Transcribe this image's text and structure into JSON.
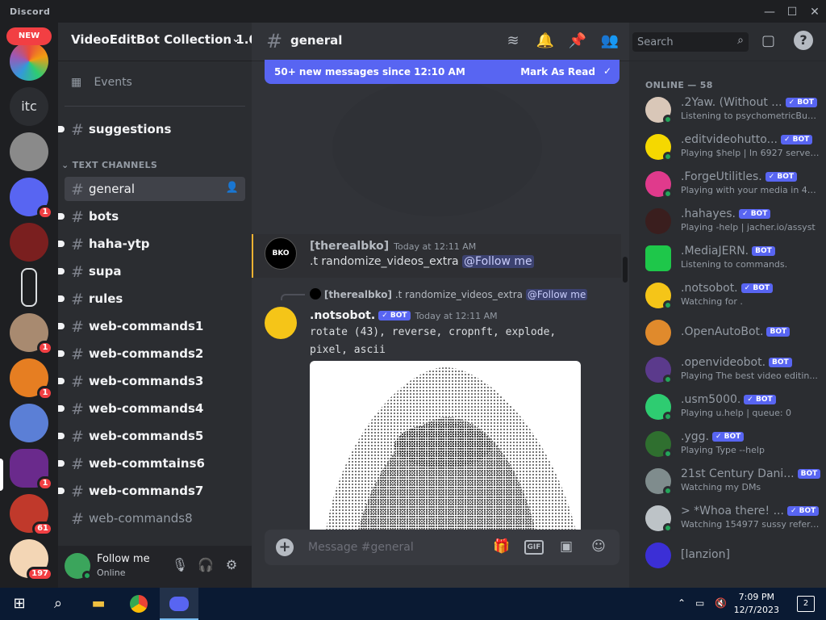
{
  "window": {
    "brand": "Discord",
    "controls": {
      "minimize": "—",
      "maximize": "☐",
      "close": "✕"
    }
  },
  "server_rail": {
    "new_badge": "NEW",
    "itc_label": "itc",
    "badges": {
      "s5": "1",
      "s8": "1",
      "s9": "1",
      "s11": "1",
      "s12": "61",
      "s13": "197"
    }
  },
  "sidebar": {
    "server_name": "VideoEditBot Collection 1.0",
    "events_label": "Events",
    "category": "TEXT CHANNELS",
    "channels": [
      {
        "name": "suggestions"
      },
      {
        "name": "general"
      },
      {
        "name": "bots"
      },
      {
        "name": "haha-ytp"
      },
      {
        "name": "supa"
      },
      {
        "name": "rules"
      },
      {
        "name": "web-commands1"
      },
      {
        "name": "web-commands2"
      },
      {
        "name": "web-commands3"
      },
      {
        "name": "web-commands4"
      },
      {
        "name": "web-commands5"
      },
      {
        "name": "web-commtains6"
      },
      {
        "name": "web-commands7"
      },
      {
        "name": "web-commands8"
      }
    ]
  },
  "user_panel": {
    "name": "Follow me",
    "status": "Online"
  },
  "chat": {
    "channel": "general",
    "new_messages": "50+ new messages since 12:10 AM",
    "mark_as_read": "Mark As Read",
    "messages": [
      {
        "author": "[therealbko]",
        "timestamp": "Today at 12:11 AM",
        "text": ".t randomize_videos_extra",
        "mention": "@Follow me"
      },
      {
        "reply_author": "[therealbko]",
        "reply_text": ".t randomize_videos_extra",
        "reply_mention": "@Follow me",
        "author": ".notsobot.",
        "bot_tag": "BOT",
        "timestamp": "Today at 12:11 AM",
        "line1": "rotate (43), reverse, cropnft, explode,",
        "line2": "pixel, ascii"
      }
    ],
    "composer_placeholder": "Message #general",
    "gif_label": "GIF"
  },
  "members": {
    "search_placeholder": "Search",
    "online_header": "ONLINE — 58",
    "bot_tag": "BOT",
    "list": [
      {
        "name": ".2Yaw. (Without ...",
        "activity": "Listening to psychometricBus...",
        "verified": true
      },
      {
        "name": ".editvideohutto...",
        "activity": "Playing $help | In 6927 server...",
        "verified": true
      },
      {
        "name": ".ForgeUtilitles.",
        "activity": "Playing with your media in 43...",
        "verified": true
      },
      {
        "name": ".hahayes.",
        "activity": "Playing -help | jacher.io/assyst",
        "verified": true
      },
      {
        "name": ".MediaJERN.",
        "activity": "Listening to commands.",
        "verified": false
      },
      {
        "name": ".notsobot.",
        "activity": "Watching for .",
        "verified": true
      },
      {
        "name": ".OpenAutoBot.",
        "activity": "",
        "verified": false
      },
      {
        "name": ".openvideobot.",
        "activity": "Playing The best video editin...",
        "verified": false
      },
      {
        "name": ".usm5000.",
        "activity": "Playing u.help | queue: 0",
        "verified": true
      },
      {
        "name": ".ygg.",
        "activity": "Playing Type --help",
        "verified": true
      },
      {
        "name": "21st Century Dani...",
        "activity": "Watching my DMs",
        "verified": false
      },
      {
        "name": "> *Whoa there! ...",
        "activity": "Watching 154977 sussy refere...",
        "verified": true
      },
      {
        "name": "[lanzion]",
        "activity": "",
        "verified": false
      }
    ]
  },
  "taskbar": {
    "time": "7:09 PM",
    "date": "12/7/2023",
    "notif_count": "2"
  },
  "colors": {
    "accent": "#5865f2",
    "online": "#23a55a",
    "danger": "#f23f43"
  }
}
